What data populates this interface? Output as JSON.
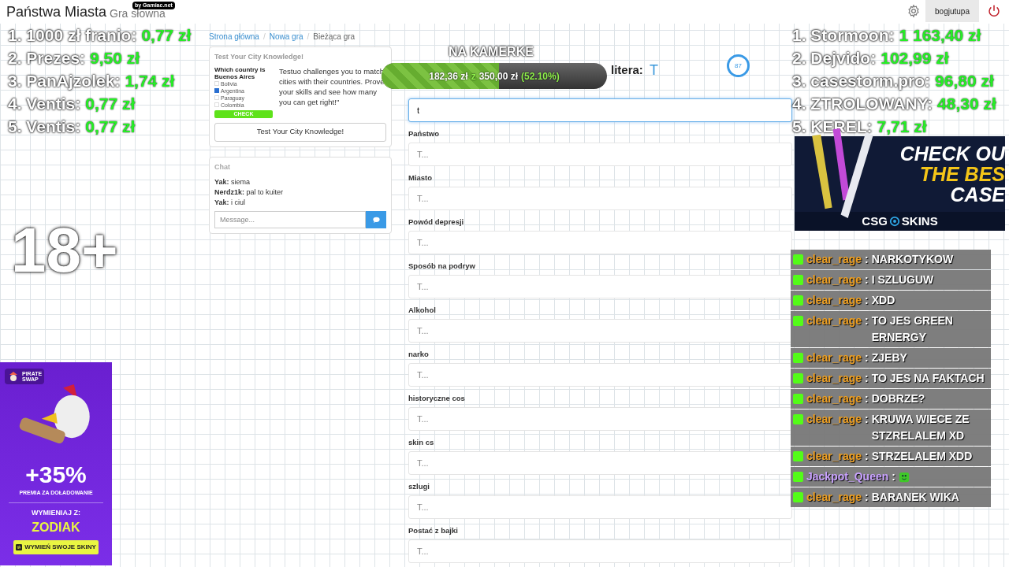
{
  "header": {
    "title": "Państwa Miasta",
    "subtitle": "Gra słowna",
    "badge": "by Gamiac.net",
    "username": "bogjutupa"
  },
  "leaderboard_left": [
    {
      "name": "1. 1000 zł franio:",
      "amount": "0,77 zł"
    },
    {
      "name": "2. Prezes:",
      "amount": "9,50 zł"
    },
    {
      "name": "3. PanAjzolek:",
      "amount": "1,74 zł"
    },
    {
      "name": "4. Ventis:",
      "amount": "0,77 zł"
    },
    {
      "name": "5. Ventis:",
      "amount": "0,77 zł"
    }
  ],
  "leaderboard_right": [
    {
      "name": "1. Stormoon:",
      "amount": "1 163,40 zł"
    },
    {
      "name": "2. Dejvido:",
      "amount": "102,99 zł"
    },
    {
      "name": "3. casestorm.pro:",
      "amount": "96,80 zł"
    },
    {
      "name": "4. ZTROLOWANY:",
      "amount": "48,30 zł"
    },
    {
      "name": "5. KEREL:",
      "amount": "7,71 zł"
    }
  ],
  "age_badge": "18+",
  "breadcrumb": {
    "separator": "/",
    "items": [
      {
        "label": "Strona główna",
        "link": true
      },
      {
        "label": "Nowa gra",
        "link": true
      },
      {
        "label": "Bieżąca gra",
        "link": false
      }
    ]
  },
  "ad_card": {
    "title": "Test Your City Knowledge!",
    "quiz": {
      "question": "Which country is Buenos Aires",
      "options": [
        {
          "label": "Bolivia",
          "checked": false
        },
        {
          "label": "Argentina",
          "checked": true
        },
        {
          "label": "Paraguay",
          "checked": false
        },
        {
          "label": "Colombia",
          "checked": false
        }
      ],
      "button": "CHECK"
    },
    "description": "Testuo challenges you to match cities with their countries. Prove your skills and see how many you can get right!\"",
    "button": "Test Your City Knowledge!"
  },
  "chat": {
    "title": "Chat",
    "messages": [
      {
        "user": "Yak:",
        "text": "siema"
      },
      {
        "user": "Nerdz1k:",
        "text": "pal to kuiter"
      },
      {
        "user": "Yak:",
        "text": "i ciul"
      }
    ],
    "placeholder": "Message..."
  },
  "game": {
    "camera_label": "NA KAMERKE",
    "goal": {
      "current": "182,36 zł",
      "of": "z",
      "target": "350,00 zł",
      "percent": "(52.10%)",
      "level": 0.521
    },
    "letter_label": "litera:",
    "letter": "T",
    "timer": "87"
  },
  "form": {
    "fields": [
      {
        "value": "t",
        "focused": true
      },
      {
        "label": "Państwo",
        "placeholder": "T...",
        "focused": false
      },
      {
        "label": "Miasto",
        "placeholder": "T...",
        "focused": false
      },
      {
        "label": "Powód depresji",
        "placeholder": "T...",
        "focused": false
      },
      {
        "label": "Sposób na podryw",
        "placeholder": "T...",
        "focused": false
      },
      {
        "label": "Alkohol",
        "placeholder": "T...",
        "focused": false
      },
      {
        "label": "narko",
        "placeholder": "T...",
        "focused": false
      },
      {
        "label": "historyczne cos",
        "placeholder": "T...",
        "focused": false
      },
      {
        "label": "skin cs",
        "placeholder": "T...",
        "focused": false
      },
      {
        "label": "szlugi",
        "placeholder": "T...",
        "focused": false
      },
      {
        "label": "Postać z bajki",
        "placeholder": "T...",
        "focused": false
      }
    ]
  },
  "banner_right": {
    "lines": [
      "CHECK OU",
      "THE BES",
      "CASE"
    ],
    "logo_left": "CSG",
    "logo_right": "SKINS"
  },
  "stream_chat": [
    {
      "kind": "text",
      "user": "clear_rage",
      "color": "#f0a020",
      "colon": ":",
      "text": "NARKOTYKOW"
    },
    {
      "kind": "text",
      "user": "clear_rage",
      "color": "#f0a020",
      "colon": ":",
      "text": "I SZLUGUW"
    },
    {
      "kind": "text",
      "user": "clear_rage",
      "color": "#f0a020",
      "colon": ":",
      "text": "XDD"
    },
    {
      "kind": "text",
      "user": "clear_rage",
      "color": "#f0a020",
      "colon": ":",
      "text": "TO JES GREEN ERNERGY"
    },
    {
      "kind": "text",
      "user": "clear_rage",
      "color": "#f0a020",
      "colon": ":",
      "text": "ZJEBY"
    },
    {
      "kind": "text",
      "user": "clear_rage",
      "color": "#f0a020",
      "colon": ":",
      "text": "TO JES NA FAKTACH"
    },
    {
      "kind": "text",
      "user": "clear_rage",
      "color": "#f0a020",
      "colon": ":",
      "text": "DOBRZE?"
    },
    {
      "kind": "text",
      "user": "clear_rage",
      "color": "#f0a020",
      "colon": ":",
      "text": "KRUWA WIECE ZE STZRELALEM XD"
    },
    {
      "kind": "text",
      "user": "clear_rage",
      "color": "#f0a020",
      "colon": ":",
      "text": "STRZELALEM XDD"
    },
    {
      "kind": "emote",
      "user": "Jackpot_Queen",
      "color": "#c9a2ff",
      "colon": ":"
    },
    {
      "kind": "text",
      "user": "clear_rage",
      "color": "#f0a020",
      "colon": ":",
      "text": "BARANEK WIKA"
    }
  ],
  "banner_left": {
    "brand_top": "PIRATE",
    "brand_bottom": "SWAP",
    "bonus": "+35%",
    "bonus_caption": "PREMIA ZA DOŁADOWANIE",
    "code_label": "WYMIENIAJ Z:",
    "code": "ZODIAK",
    "button": "WYMIEŃ SWOJE SKINY"
  }
}
